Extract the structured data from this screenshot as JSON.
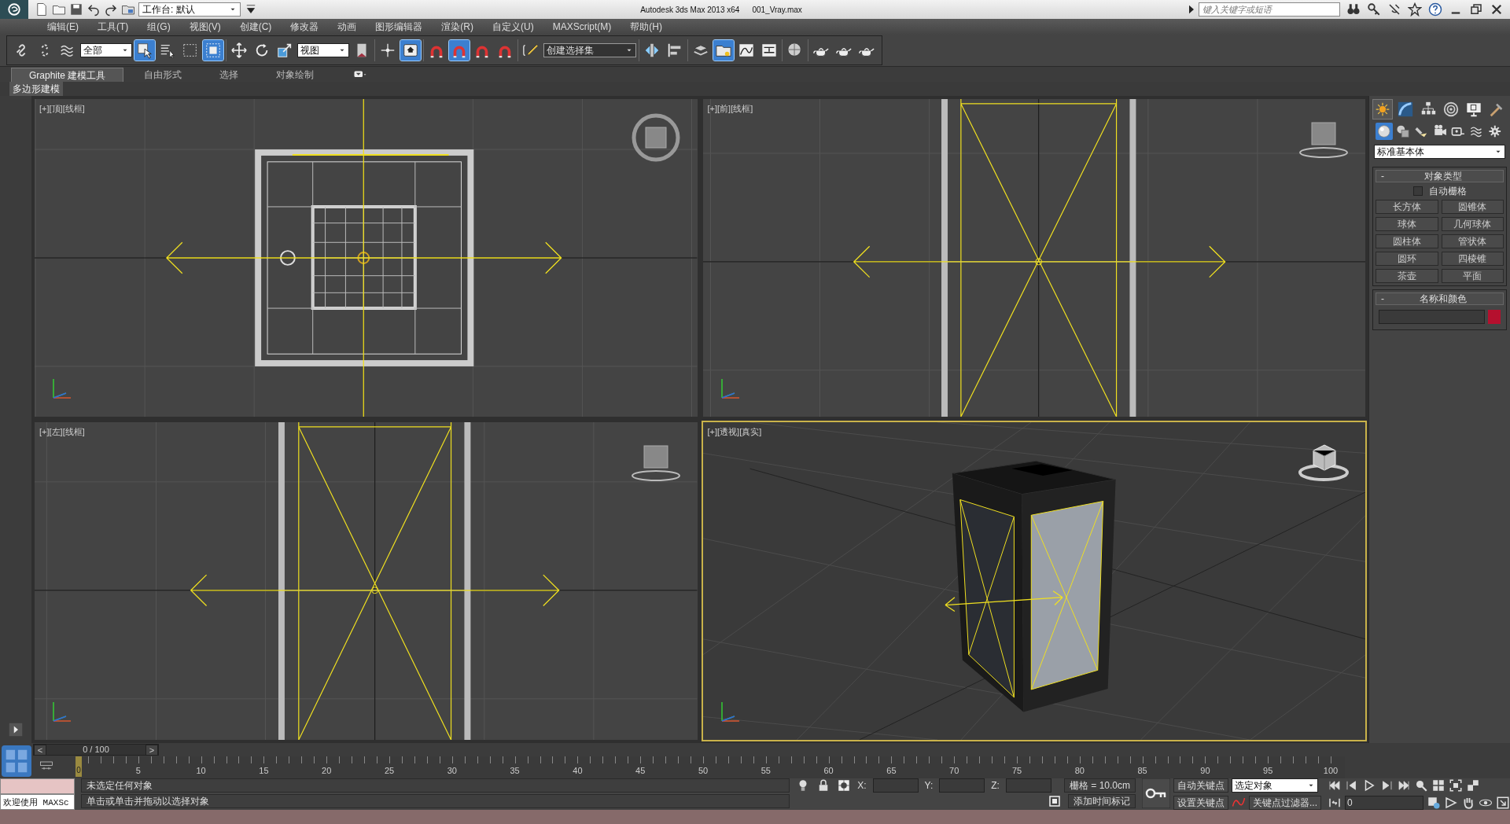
{
  "title_bar": {
    "workspace": "工作台: 默认",
    "app_title": "Autodesk 3ds Max 2013 x64",
    "file_name": "001_Vray.max",
    "search": {
      "placeholder": "键入关键字或短语"
    }
  },
  "menu": [
    "编辑(E)",
    "工具(T)",
    "组(G)",
    "视图(V)",
    "创建(C)",
    "修改器",
    "动画",
    "图形编辑器",
    "渲染(R)",
    "自定义(U)",
    "MAXScript(M)",
    "帮助(H)"
  ],
  "toolbar": [
    {
      "kind": "icon",
      "selected": false
    },
    {
      "kind": "icon",
      "selected": false
    },
    {
      "kind": "icon",
      "selected": false
    },
    {
      "kind": "dropdown",
      "value": "全部"
    },
    {
      "kind": "icon",
      "selected": true
    },
    {
      "kind": "icon",
      "selected": false
    },
    {
      "kind": "icon",
      "selected": false
    },
    {
      "kind": "icon",
      "selected": true
    },
    {
      "kind": "separator"
    },
    {
      "kind": "icon",
      "selected": false
    },
    {
      "kind": "icon",
      "selected": false
    },
    {
      "kind": "icon",
      "selected": false
    },
    {
      "kind": "dropdown",
      "value": "视图"
    },
    {
      "kind": "icon",
      "selected": false
    },
    {
      "kind": "separator"
    },
    {
      "kind": "icon",
      "selected": false
    },
    {
      "kind": "icon",
      "selected": true
    },
    {
      "kind": "separator"
    },
    {
      "kind": "icon",
      "selected": false
    },
    {
      "kind": "icon",
      "selected": true
    },
    {
      "kind": "icon",
      "selected": false
    },
    {
      "kind": "icon",
      "selected": false
    },
    {
      "kind": "separator"
    },
    {
      "kind": "icon",
      "selected": false
    },
    {
      "kind": "dropdown",
      "value": "创建选择集"
    },
    {
      "kind": "separator"
    },
    {
      "kind": "icon",
      "selected": false
    },
    {
      "kind": "icon",
      "selected": false
    },
    {
      "kind": "separator"
    },
    {
      "kind": "icon",
      "selected": false
    },
    {
      "kind": "icon",
      "selected": true
    },
    {
      "kind": "icon",
      "selected": false
    },
    {
      "kind": "icon",
      "selected": false
    },
    {
      "kind": "separator"
    },
    {
      "kind": "icon",
      "selected": false
    },
    {
      "kind": "separator"
    },
    {
      "kind": "icon",
      "selected": false
    },
    {
      "kind": "icon",
      "selected": false
    },
    {
      "kind": "icon",
      "selected": false
    }
  ],
  "ribbon": {
    "tabs": [
      {
        "label": "Graphite 建模工具",
        "selected": true
      },
      {
        "label": "自由形式",
        "selected": false
      },
      {
        "label": "选择",
        "selected": false
      },
      {
        "label": "对象绘制",
        "selected": false
      }
    ],
    "panel_label": "多边形建模"
  },
  "viewports": [
    {
      "kind": "top",
      "label": "[+][顶][线框]",
      "active": false
    },
    {
      "kind": "front",
      "label": "[+][前][线框]",
      "active": false
    },
    {
      "kind": "left",
      "label": "[+][左][线框]",
      "active": false
    },
    {
      "kind": "perspective",
      "label": "[+][透视][真实]",
      "active": true
    }
  ],
  "command_panel": {
    "tabs": [
      {
        "selected": true
      },
      {
        "selected": false
      },
      {
        "selected": false
      },
      {
        "selected": false
      },
      {
        "selected": false
      },
      {
        "selected": false
      }
    ],
    "categories": [
      {
        "selected": true
      },
      {
        "selected": false
      },
      {
        "selected": false
      },
      {
        "selected": false
      },
      {
        "selected": false
      },
      {
        "selected": false
      },
      {
        "selected": false
      }
    ],
    "object_category": "标准基本体",
    "object_type": {
      "collapse": "-",
      "title": "对象类型",
      "autogrid": {
        "label": "自动栅格",
        "checked": false
      },
      "buttons": [
        "长方体",
        "圆锥体",
        "球体",
        "几何球体",
        "圆柱体",
        "管状体",
        "圆环",
        "四棱锥",
        "茶壶",
        "平面"
      ]
    },
    "name_color": {
      "collapse": "-",
      "title": "名称和颜色",
      "color": "#b5102e"
    }
  },
  "timeline": {
    "prev": "<",
    "position": "0 / 100",
    "next": ">",
    "current_frame": "0",
    "ruler_labels": [
      "5",
      "10",
      "15",
      "20",
      "25",
      "30",
      "35",
      "40",
      "45",
      "50",
      "55",
      "60",
      "65",
      "70",
      "75",
      "80",
      "85",
      "90",
      "95",
      "100"
    ]
  },
  "status_bar": {
    "listener_text": "欢迎使用 MAXSc",
    "status": "未选定任何对象",
    "prompt": "单击或单击并拖动以选择对象",
    "x_label": "X:",
    "y_label": "Y:",
    "z_label": "Z:",
    "grid": "栅格 = 10.0cm",
    "add_time_tag": "添加时间标记",
    "auto_key": "自动关键点",
    "set_key": "设置关键点",
    "key_mode": "选定对象",
    "key_filters": "关键点过滤器...",
    "frame": "0"
  }
}
